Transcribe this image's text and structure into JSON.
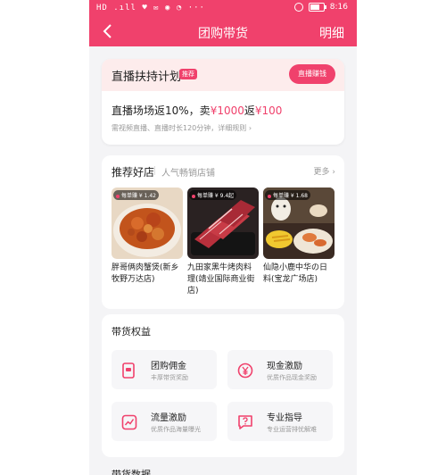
{
  "status_bar": {
    "left_icons": "HD .ıll ♥ ✉ ◉ ◔ ···",
    "time": "8:16"
  },
  "header": {
    "title": "团购带货",
    "right": "明细",
    "back_icon": "chevron-left-icon"
  },
  "live_plan": {
    "title": "直播扶持计划",
    "tag": "推荐",
    "button": "直播赚钱",
    "promo_prefix": "直播场场返10%，卖",
    "promo_amount1": "¥1000",
    "promo_mid": "返",
    "promo_amount2": "¥100",
    "sub": "需视频直播、直播时长120分钟，详细规则",
    "sub_arrow": "›"
  },
  "recommend": {
    "title": "推荐好店",
    "subtitle": "人气畅销店铺",
    "more": "更多 ›",
    "shops": [
      {
        "earn": "每单赚 ¥ 1.42",
        "name": "胖哥俩肉蟹煲(新乡牧野万达店)"
      },
      {
        "earn": "每单赚 ¥ 9.4起",
        "name": "九田家黑牛烤肉料理(靖业国际商业街店)"
      },
      {
        "earn": "每单赚 ¥ 1.68",
        "name": "仙隐小鹿中华の日料(宝龙广场店)"
      }
    ]
  },
  "benefits": {
    "title": "带货权益",
    "items": [
      {
        "name": "团购佣金",
        "desc": "丰厚带货奖励",
        "icon": "commission-icon"
      },
      {
        "name": "现金激励",
        "desc": "优质作品现金奖励",
        "icon": "yen-icon"
      },
      {
        "name": "流量激励",
        "desc": "优质作品海量曝光",
        "icon": "trend-icon"
      },
      {
        "name": "专业指导",
        "desc": "专业运营排忧解难",
        "icon": "question-icon"
      }
    ]
  },
  "bottom_section_title": "带货数据",
  "colors": {
    "accent": "#f0416c"
  }
}
